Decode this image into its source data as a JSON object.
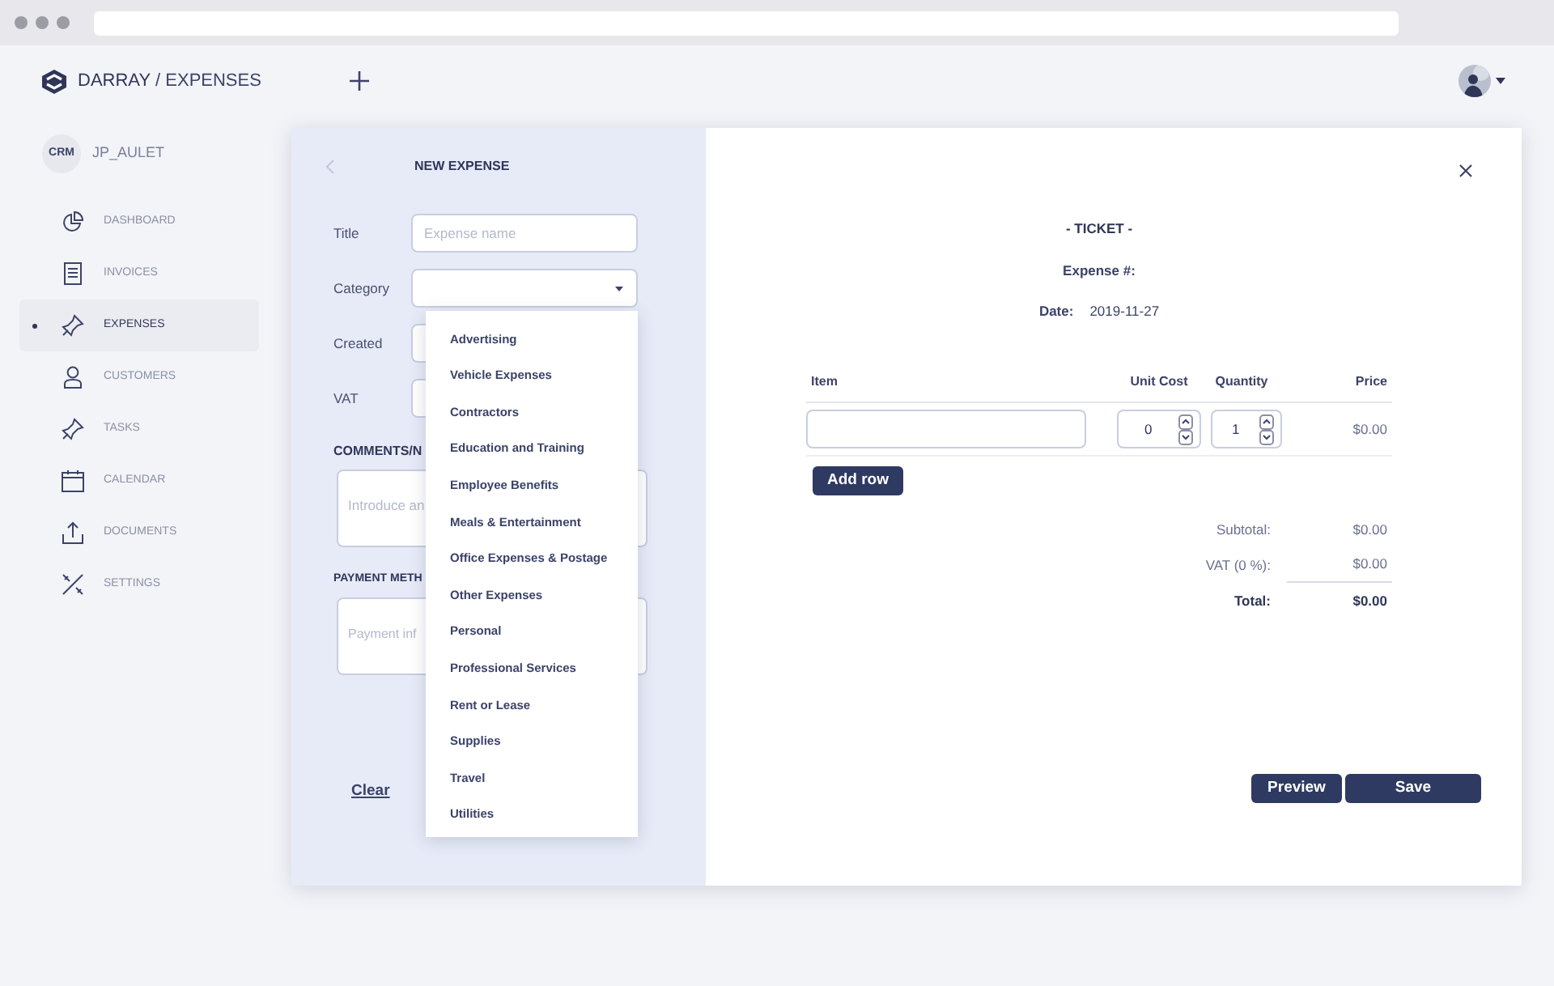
{
  "header": {
    "brand": "DARRAY",
    "section": "/ EXPENSES"
  },
  "user": {
    "badge": "CRM",
    "name": "JP_AULET"
  },
  "sidebar": {
    "items": [
      {
        "label": "DASHBOARD",
        "selected": false
      },
      {
        "label": "INVOICES",
        "selected": false
      },
      {
        "label": "EXPENSES",
        "selected": true
      },
      {
        "label": "CUSTOMERS",
        "selected": false
      },
      {
        "label": "TASKS",
        "selected": false
      },
      {
        "label": "CALENDAR",
        "selected": false
      },
      {
        "label": "DOCUMENTS",
        "selected": false
      },
      {
        "label": "SETTINGS",
        "selected": false
      }
    ]
  },
  "form": {
    "title": "NEW EXPENSE",
    "fields": [
      {
        "label": "Title",
        "kind": "text",
        "placeholder": "Expense name"
      },
      {
        "label": "Category",
        "kind": "select",
        "expanded": true
      },
      {
        "label": "Created",
        "kind": "text"
      },
      {
        "label": "VAT",
        "kind": "text"
      }
    ],
    "comments": {
      "heading": "COMMENTS/N",
      "placeholder": "Introduce an"
    },
    "payment": {
      "heading": "PAYMENT METH",
      "placeholder": "Payment inf"
    },
    "clear": "Clear"
  },
  "dropdown": {
    "options": [
      "Advertising",
      "Vehicle Expenses",
      "Contractors",
      "Education and Training",
      "Employee Benefits",
      "Meals & Entertainment",
      "Office Expenses & Postage",
      "Other Expenses",
      "Personal",
      "Professional Services",
      "Rent or Lease",
      "Supplies",
      "Travel",
      "Utilities"
    ]
  },
  "ticket": {
    "heading": "- TICKET -",
    "expense_label": "Expense #:",
    "date_label": "Date:",
    "date": "2019-11-27",
    "columns": [
      "Item",
      "Unit Cost",
      "Quantity",
      "Price"
    ],
    "rows": [
      {
        "unit_cost": "0",
        "quantity": "1",
        "price": "$0.00"
      }
    ],
    "add_row": "Add row",
    "totals": [
      {
        "label": "Subtotal:",
        "value": "$0.00",
        "bold": false
      },
      {
        "label": "VAT (0 %):",
        "value": "$0.00",
        "bold": false
      },
      {
        "label": "Total:",
        "value": "$0.00",
        "bold": true
      }
    ],
    "buttons": [
      "Preview",
      "Save"
    ]
  }
}
